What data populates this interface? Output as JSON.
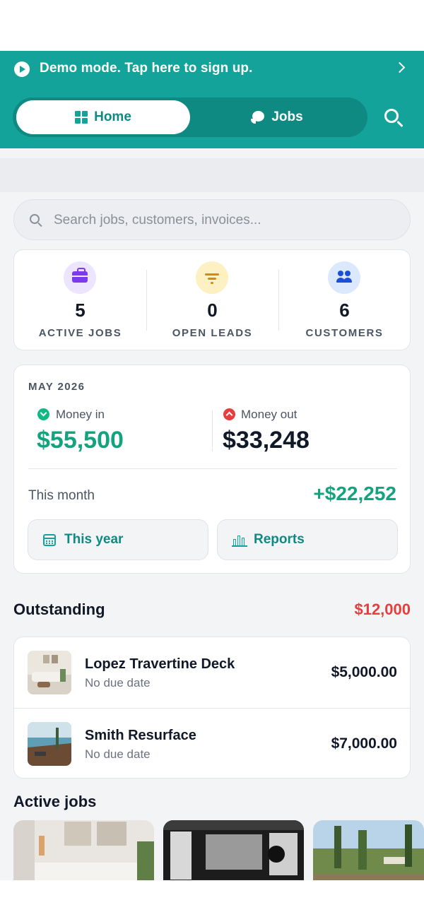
{
  "banner": {
    "text": "Demo mode. Tap here to sign up."
  },
  "tabs": [
    {
      "label": "Home"
    },
    {
      "label": "Jobs"
    }
  ],
  "search": {
    "placeholder": "Search jobs, customers, invoices..."
  },
  "stats": [
    {
      "value": "5",
      "label": "ACTIVE JOBS",
      "icon": "briefcase-icon"
    },
    {
      "value": "0",
      "label": "OPEN LEADS",
      "icon": "filter-icon"
    },
    {
      "value": "6",
      "label": "CUSTOMERS",
      "icon": "people-icon"
    }
  ],
  "money": {
    "period": "MAY 2026",
    "in_label": "Money in",
    "in_amount": "$55,500",
    "out_label": "Money out",
    "out_amount": "$33,248",
    "month_label": "This month",
    "net": "+$22,252",
    "year_button": "This year",
    "reports_button": "Reports"
  },
  "outstanding": {
    "title": "Outstanding",
    "total": "$12,000",
    "items": [
      {
        "name": "Lopez Travertine Deck",
        "due": "No due date",
        "amount": "$5,000.00"
      },
      {
        "name": "Smith Resurface",
        "due": "No due date",
        "amount": "$7,000.00"
      }
    ]
  },
  "active_jobs": {
    "title": "Active jobs"
  },
  "colors": {
    "brand": "#14a39a",
    "brand_dark": "#0f8a83",
    "money_in": "#14a37f",
    "money_out": "#e53e3e"
  }
}
